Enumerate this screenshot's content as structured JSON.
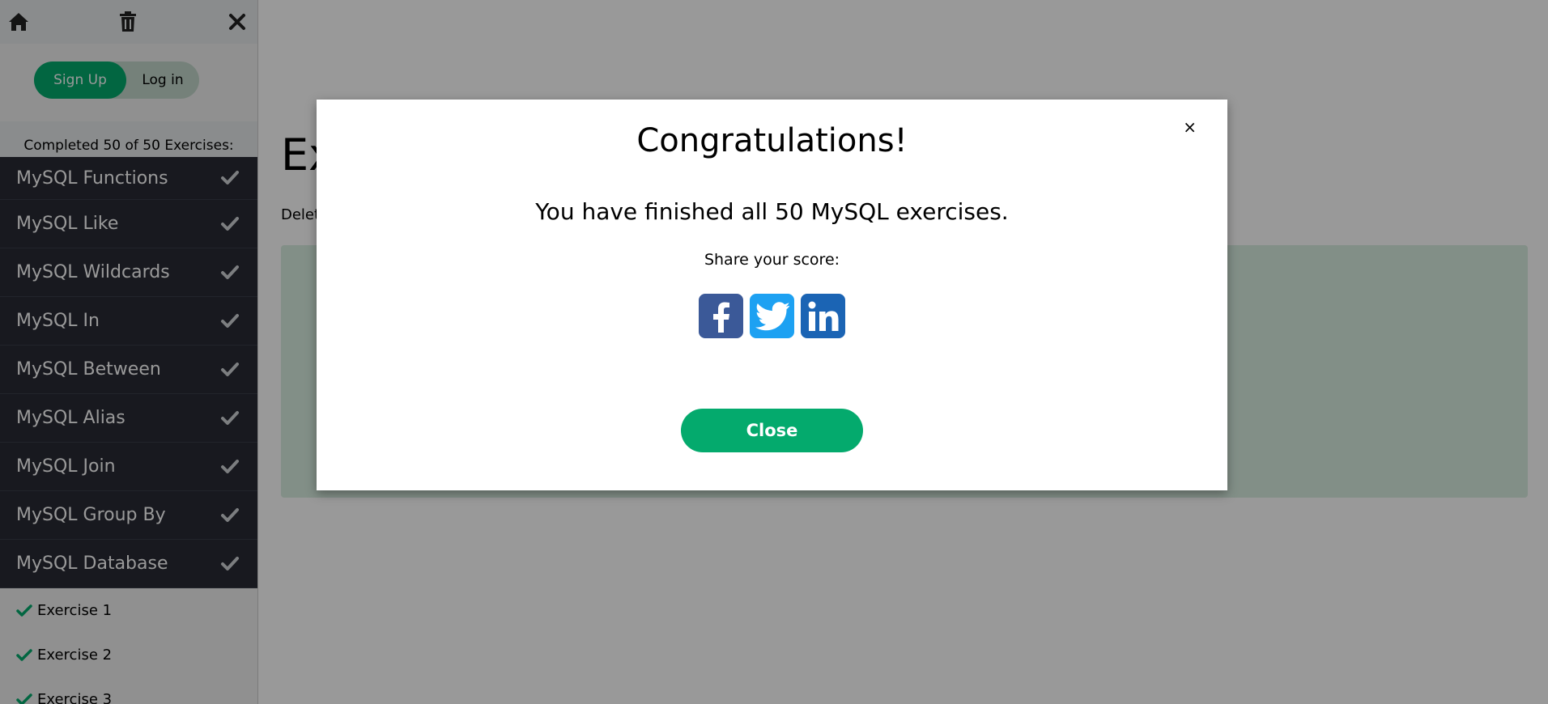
{
  "sidebar": {
    "auth": {
      "signup_label": "Sign Up",
      "login_label": "Log in"
    },
    "progress_text": "Completed 50 of 50 Exercises:",
    "topics": [
      {
        "label": "MySQL Functions",
        "done": true
      },
      {
        "label": "MySQL Like",
        "done": true
      },
      {
        "label": "MySQL Wildcards",
        "done": true
      },
      {
        "label": "MySQL In",
        "done": true
      },
      {
        "label": "MySQL Between",
        "done": true
      },
      {
        "label": "MySQL Alias",
        "done": true
      },
      {
        "label": "MySQL Join",
        "done": true
      },
      {
        "label": "MySQL Group By",
        "done": true
      },
      {
        "label": "MySQL Database",
        "done": true
      }
    ],
    "exercises": [
      {
        "label": "Exercise 1",
        "done": true
      },
      {
        "label": "Exercise 2",
        "done": true
      },
      {
        "label": "Exercise 3",
        "done": true
      }
    ]
  },
  "main": {
    "title_partial": "Ex",
    "subtitle_partial": "Delet"
  },
  "modal": {
    "title": "Congratulations!",
    "message": "You have finished all 50 MySQL exercises.",
    "share_label": "Share your score:",
    "close_x": "×",
    "close_button": "Close",
    "social_icons": [
      "facebook-icon",
      "twitter-icon",
      "linkedin-icon"
    ]
  },
  "colors": {
    "accent_green": "#04aa6d",
    "sidebar_dark": "#282a35",
    "facebook": "#3b5998",
    "twitter": "#1da1f2",
    "linkedin": "#1b64b4"
  }
}
